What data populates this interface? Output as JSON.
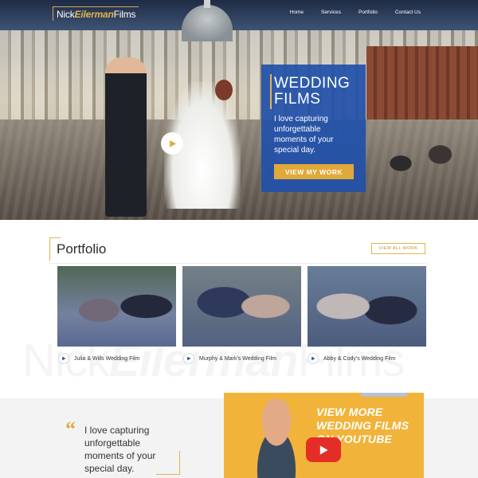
{
  "brand": {
    "first": "Nick",
    "middle": "Eilerman",
    "last": "Films"
  },
  "nav": {
    "items": [
      "Home",
      "Services",
      "Portfolio",
      "Contact Us"
    ]
  },
  "hero": {
    "title_line1": "WEDDING",
    "title_line2": "FILMS",
    "description": "I love capturing unforgettable moments of your special day.",
    "cta_label": "VIEW MY WORK"
  },
  "portfolio": {
    "title": "Portfolio",
    "view_all_label": "VIEW ALL WORK",
    "items": [
      {
        "title": "Julia & Wills Wedding Film"
      },
      {
        "title": "Murphy & Mark's Wedding Film"
      },
      {
        "title": "Abby & Cody's Wedding Film"
      }
    ]
  },
  "quote": {
    "mark": "“",
    "text": "I love capturing unforgettable moments of your special day."
  },
  "youtube_promo": {
    "text": "VIEW MORE WEDDING FILMS ON YOUTUBE"
  },
  "colors": {
    "accent_gold": "#e0a93a",
    "hero_card_blue": "#2150aa",
    "youtube_red": "#e52d27"
  },
  "icons": {
    "hero_play": "play-icon",
    "caption_play": "play-icon",
    "youtube": "youtube-play-icon"
  }
}
